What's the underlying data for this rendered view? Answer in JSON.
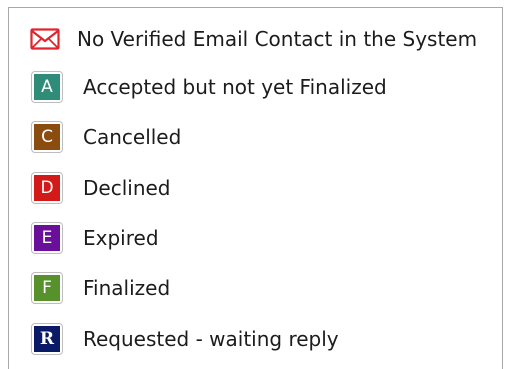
{
  "legend": {
    "email_note": {
      "label": "No Verified Email Contact in the System",
      "icon": "envelope-icon",
      "color": "#e0242d"
    },
    "statuses": [
      {
        "letter": "A",
        "label": "Accepted but not yet Finalized",
        "color": "#2f8c78"
      },
      {
        "letter": "C",
        "label": "Cancelled",
        "color": "#8b4c10"
      },
      {
        "letter": "D",
        "label": "Declined",
        "color": "#d21b18"
      },
      {
        "letter": "E",
        "label": "Expired",
        "color": "#6a0f9a"
      },
      {
        "letter": "F",
        "label": "Finalized",
        "color": "#56912b"
      },
      {
        "letter": "R",
        "label": "Requested - waiting reply",
        "color": "#0b1a66"
      }
    ]
  }
}
